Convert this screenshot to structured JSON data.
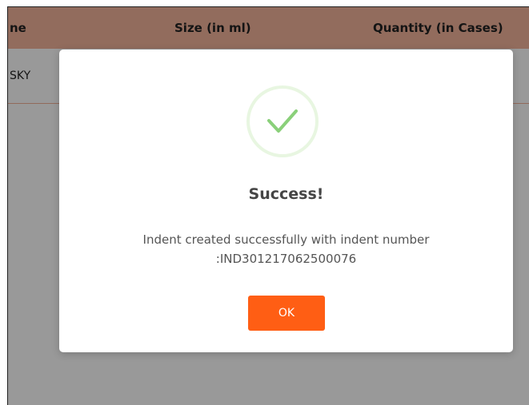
{
  "table": {
    "headers": {
      "name": "ne",
      "size": "Size (in ml)",
      "quantity": "Quantity (in Cases)"
    },
    "rows": [
      {
        "name": "SKY"
      }
    ]
  },
  "modal": {
    "icon": "success-check-icon",
    "title": "Success!",
    "message_line1": "Indent created successfully with indent number",
    "message_line2": ":IND301217062500076",
    "ok_label": "OK"
  },
  "colors": {
    "header_bg": "#f4b49b",
    "ok_button": "#ff5e14",
    "check_green": "#8ad07a"
  }
}
